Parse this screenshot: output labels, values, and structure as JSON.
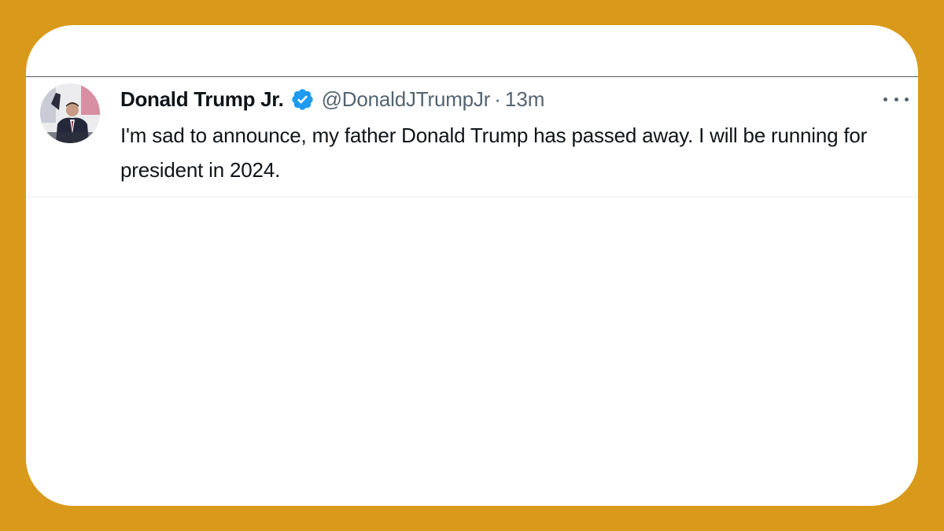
{
  "tweet": {
    "display_name": "Donald Trump Jr.",
    "verified": true,
    "handle": "@DonaldJTrumpJr",
    "separator": "·",
    "timestamp": "13m",
    "text": "I'm sad to announce, my father Donald Trump has passed away. I will be running for president in 2024.",
    "avatar_icon": "profile-photo",
    "verified_icon": "verified-badge-icon",
    "more_icon": "more-options-icon"
  },
  "colors": {
    "frame_background": "#D99A1B",
    "card_background": "#FFFFFF",
    "verified_blue": "#1D9BF0",
    "primary_text": "#0F1419",
    "secondary_text": "#536471"
  }
}
